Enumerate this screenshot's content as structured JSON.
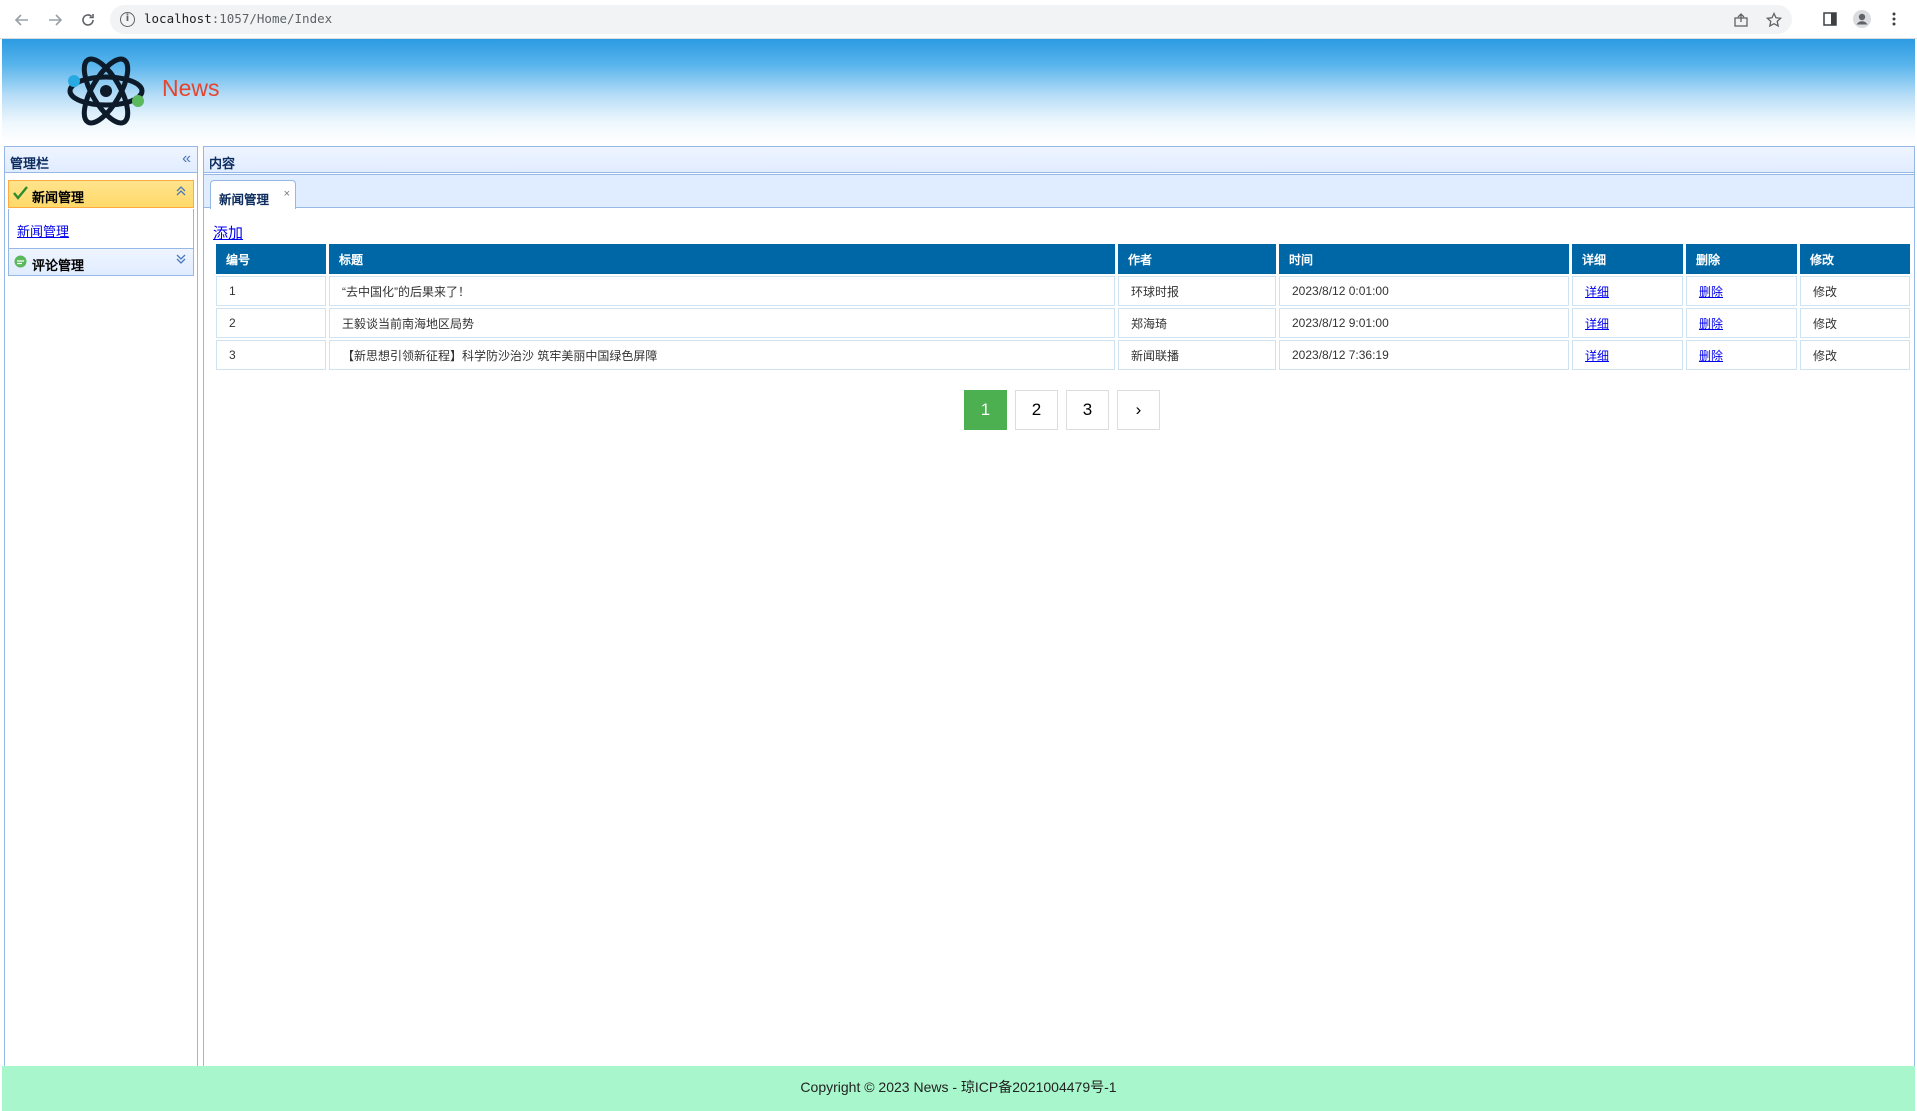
{
  "browser": {
    "url_host": "localhost",
    "url_rest": ":1057/Home/Index"
  },
  "header": {
    "brand": "News"
  },
  "sidebar": {
    "title": "管理栏",
    "groups": [
      {
        "label": "新闻管理",
        "icon": "check-icon",
        "expanded": true,
        "items": [
          {
            "label": "新闻管理"
          }
        ]
      },
      {
        "label": "评论管理",
        "icon": "comment-icon",
        "expanded": false,
        "items": []
      }
    ]
  },
  "content": {
    "title": "内容",
    "tab": {
      "label": "新闻管理",
      "close": "×"
    },
    "add_label": "添加",
    "table": {
      "columns": [
        "编号",
        "标题",
        "作者",
        "时间",
        "详细",
        "删除",
        "修改"
      ],
      "rows": [
        {
          "id": "1",
          "title": "“去中国化”的后果来了！",
          "author": "环球时报",
          "time": "2023/8/12 0:01:00",
          "detail": "详细",
          "delete": "删除",
          "edit": "修改"
        },
        {
          "id": "2",
          "title": "王毅谈当前南海地区局势",
          "author": "郑海琦",
          "time": "2023/8/12 9:01:00",
          "detail": "详细",
          "delete": "删除",
          "edit": "修改"
        },
        {
          "id": "3",
          "title": "【新思想引领新征程】科学防沙治沙 筑牢美丽中国绿色屏障",
          "author": "新闻联播",
          "time": "2023/8/12 7:36:19",
          "detail": "详细",
          "delete": "删除",
          "edit": "修改"
        }
      ]
    },
    "pager": {
      "pages": [
        "1",
        "2",
        "3"
      ],
      "current": "1",
      "next": "›"
    }
  },
  "footer": {
    "text": "Copyright © 2023 News - 琼ICP备2021004479号-1"
  },
  "colors": {
    "table_header": "#0067a6",
    "pager_active": "#4caf50",
    "footer_bg": "#a8f7cc",
    "brand": "#e5452e"
  }
}
